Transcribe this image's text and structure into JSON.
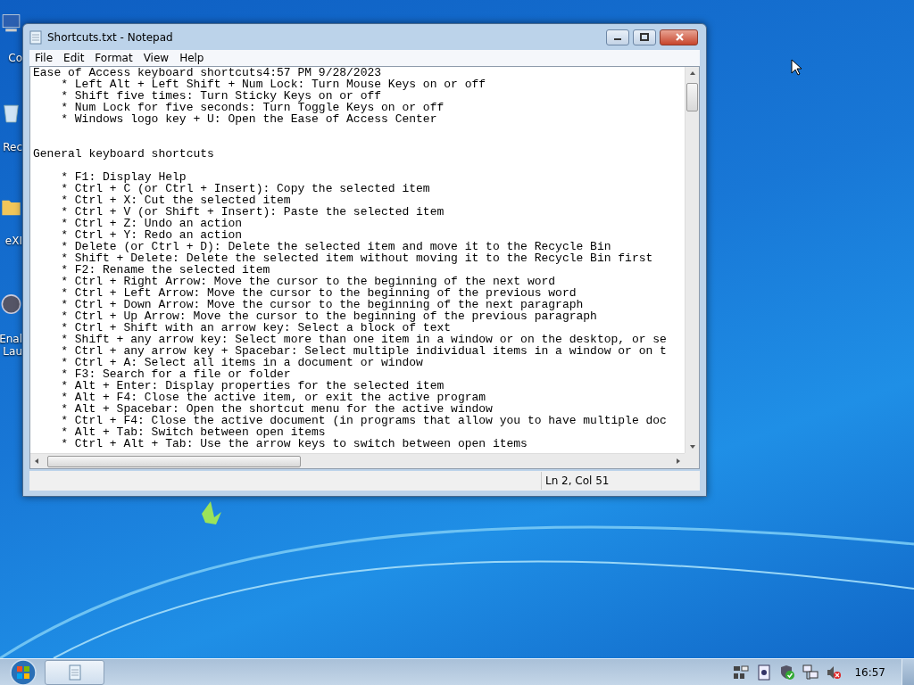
{
  "desktop_icons": [
    {
      "label": [
        "Co"
      ]
    },
    {
      "label": [
        "Rec"
      ]
    },
    {
      "label": [
        "eXI"
      ]
    },
    {
      "label": [
        "Enal",
        "Lau"
      ]
    }
  ],
  "window": {
    "title": "Shortcuts.txt - Notepad"
  },
  "menu": [
    "File",
    "Edit",
    "Format",
    "View",
    "Help"
  ],
  "lines": [
    {
      "kind": "heading",
      "text": "Ease of Access keyboard shortcuts4:57 PM 9/28/2023"
    },
    {
      "kind": "bullet",
      "text": "* Left Alt + Left Shift + Num Lock: Turn Mouse Keys on or off"
    },
    {
      "kind": "bullet",
      "text": "* Shift five times: Turn Sticky Keys on or off"
    },
    {
      "kind": "bullet",
      "text": "* Num Lock for five seconds: Turn Toggle Keys on or off"
    },
    {
      "kind": "bullet",
      "text": "* Windows logo key + U: Open the Ease of Access Center"
    },
    {
      "kind": "blank"
    },
    {
      "kind": "blank"
    },
    {
      "kind": "heading",
      "text": "General keyboard shortcuts"
    },
    {
      "kind": "blank"
    },
    {
      "kind": "bullet",
      "text": "* F1: Display Help"
    },
    {
      "kind": "bullet",
      "text": "* Ctrl + C (or Ctrl + Insert): Copy the selected item"
    },
    {
      "kind": "bullet",
      "text": "* Ctrl + X: Cut the selected item"
    },
    {
      "kind": "bullet",
      "text": "* Ctrl + V (or Shift + Insert): Paste the selected item"
    },
    {
      "kind": "bullet",
      "text": "* Ctrl + Z: Undo an action"
    },
    {
      "kind": "bullet",
      "text": "* Ctrl + Y: Redo an action"
    },
    {
      "kind": "bullet",
      "text": "* Delete (or Ctrl + D): Delete the selected item and move it to the Recycle Bin"
    },
    {
      "kind": "bullet",
      "text": "* Shift + Delete: Delete the selected item without moving it to the Recycle Bin first"
    },
    {
      "kind": "bullet",
      "text": "* F2: Rename the selected item"
    },
    {
      "kind": "bullet",
      "text": "* Ctrl + Right Arrow: Move the cursor to the beginning of the next word"
    },
    {
      "kind": "bullet",
      "text": "* Ctrl + Left Arrow: Move the cursor to the beginning of the previous word"
    },
    {
      "kind": "bullet",
      "text": "* Ctrl + Down Arrow: Move the cursor to the beginning of the next paragraph"
    },
    {
      "kind": "bullet",
      "text": "* Ctrl + Up Arrow: Move the cursor to the beginning of the previous paragraph"
    },
    {
      "kind": "bullet",
      "text": "* Ctrl + Shift with an arrow key: Select a block of text"
    },
    {
      "kind": "bullet",
      "text": "* Shift + any arrow key: Select more than one item in a window or on the desktop, or se"
    },
    {
      "kind": "bullet",
      "text": "* Ctrl + any arrow key + Spacebar: Select multiple individual items in a window or on t"
    },
    {
      "kind": "bullet",
      "text": "* Ctrl + A: Select all items in a document or window"
    },
    {
      "kind": "bullet",
      "text": "* F3: Search for a file or folder"
    },
    {
      "kind": "bullet",
      "text": "* Alt + Enter: Display properties for the selected item"
    },
    {
      "kind": "bullet",
      "text": "* Alt + F4: Close the active item, or exit the active program"
    },
    {
      "kind": "bullet",
      "text": "* Alt + Spacebar: Open the shortcut menu for the active window"
    },
    {
      "kind": "bullet",
      "text": "* Ctrl + F4: Close the active document (in programs that allow you to have multiple doc"
    },
    {
      "kind": "bullet",
      "text": "* Alt + Tab: Switch between open items"
    },
    {
      "kind": "bullet",
      "text": "* Ctrl + Alt + Tab: Use the arrow keys to switch between open items"
    }
  ],
  "status_bar": {
    "position": "Ln 2, Col 51"
  },
  "taskbar": {
    "clock": "16:57"
  }
}
